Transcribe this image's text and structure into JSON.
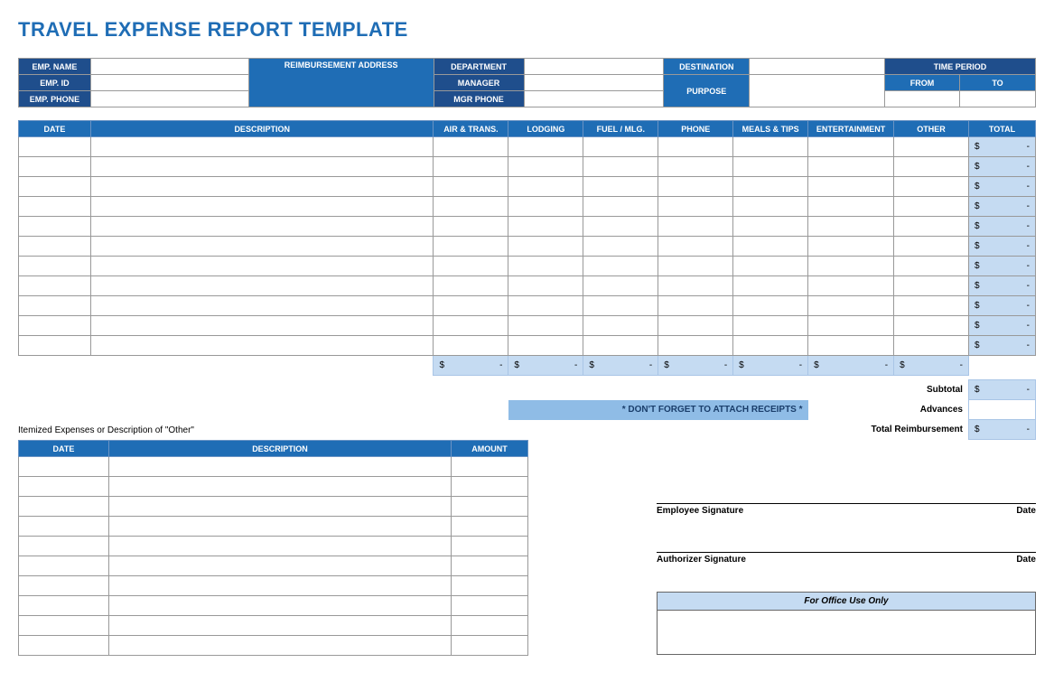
{
  "title": "TRAVEL EXPENSE REPORT TEMPLATE",
  "header": {
    "emp_name_lab": "EMP. NAME",
    "emp_id_lab": "EMP. ID",
    "emp_phone_lab": "EMP. PHONE",
    "reimb_lab": "REIMBURSEMENT ADDRESS",
    "dept_lab": "DEPARTMENT",
    "manager_lab": "MANAGER",
    "mgrphone_lab": "MGR PHONE",
    "dest_lab": "DESTINATION",
    "purpose_lab": "PURPOSE",
    "time_lab": "TIME PERIOD",
    "from_lab": "FROM",
    "to_lab": "TO",
    "emp_name": "",
    "emp_id": "",
    "emp_phone": "",
    "reimb": "",
    "dept": "",
    "manager": "",
    "mgrphone": "",
    "dest": "",
    "purpose": "",
    "from": "",
    "to": ""
  },
  "columns": {
    "date": "DATE",
    "desc": "DESCRIPTION",
    "air": "AIR & TRANS.",
    "lodging": "LODGING",
    "fuel": "FUEL / MLG.",
    "phone": "PHONE",
    "meals": "MEALS & TIPS",
    "ent": "ENTERTAINMENT",
    "other": "OTHER",
    "total": "TOTAL"
  },
  "currency": "$",
  "dash": "-",
  "row_totals": [
    "-",
    "-",
    "-",
    "-",
    "-",
    "-",
    "-",
    "-",
    "-",
    "-",
    "-"
  ],
  "col_sums": {
    "air": "-",
    "lodging": "-",
    "fuel": "-",
    "phone": "-",
    "meals": "-",
    "ent": "-",
    "other": "-"
  },
  "summary": {
    "subtotal_lab": "Subtotal",
    "advances_lab": "Advances",
    "totalreimb_lab": "Total Reimbursement",
    "subtotal": "-",
    "advances": "",
    "totalreimb": "-"
  },
  "reminder": "* DON'T FORGET TO ATTACH RECEIPTS *",
  "other_title": "Itemized Expenses or Description of \"Other\"",
  "other_cols": {
    "date": "DATE",
    "desc": "DESCRIPTION",
    "amount": "AMOUNT"
  },
  "sig": {
    "emp": "Employee Signature",
    "auth": "Authorizer Signature",
    "date": "Date"
  },
  "office_lab": "For Office Use Only"
}
